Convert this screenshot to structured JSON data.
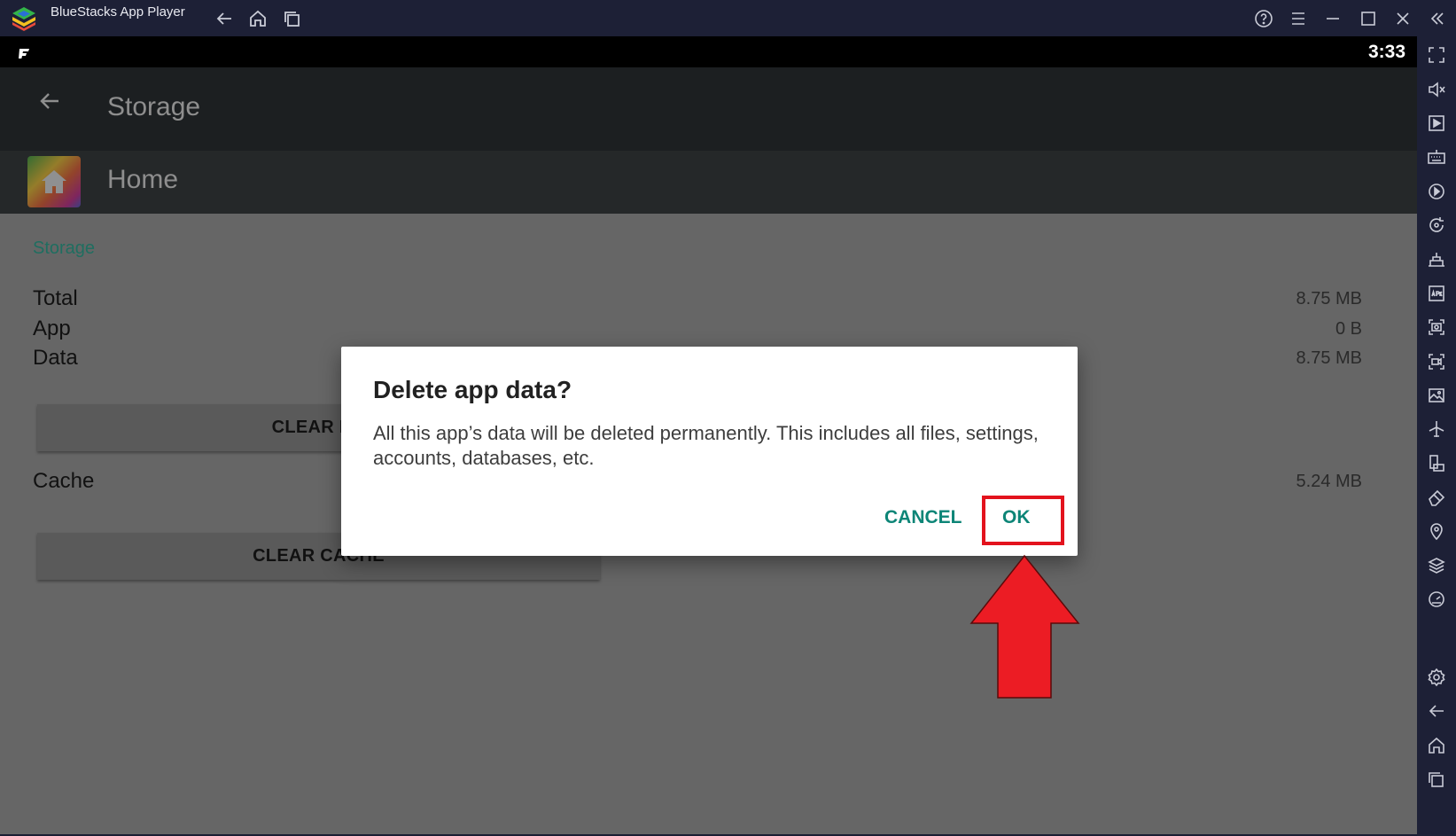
{
  "window": {
    "title": "BlueStacks App Player",
    "colors": {
      "frame": "#1d2036",
      "accent": "#0d8577",
      "highlight": "#e3131d"
    }
  },
  "titlebar_icons": [
    "back-icon",
    "home-icon",
    "recent-apps-icon",
    "help-icon",
    "menu-icon",
    "minimize-icon",
    "maximize-icon",
    "close-icon",
    "collapse-sidebar-icon"
  ],
  "statusbar": {
    "time": "3:33"
  },
  "appbar": {
    "title": "Storage"
  },
  "app_row": {
    "name": "Home"
  },
  "storage": {
    "section_title": "Storage",
    "rows": [
      {
        "label": "Total",
        "value": "8.75 MB"
      },
      {
        "label": "App",
        "value": "0 B"
      },
      {
        "label": "Data",
        "value": "8.75 MB"
      }
    ],
    "clear_data_label": "CLEAR DA",
    "cache_label": "Cache",
    "cache_value": "5.24 MB",
    "clear_cache_label": "CLEAR CACHE"
  },
  "dialog": {
    "title": "Delete app data?",
    "body": "All this app’s data will be deleted permanently. This includes all files, settings, accounts, databases, etc.",
    "cancel_label": "CANCEL",
    "ok_label": "OK"
  },
  "sidebar_icons": [
    "fullscreen-icon",
    "volume-icon",
    "media-icon",
    "keyboard-icon",
    "macro-icon",
    "rotate-icon",
    "build-icon",
    "apk-icon",
    "screenshot-icon",
    "record-icon",
    "gallery-icon",
    "airplane-icon",
    "device-icon",
    "eraser-icon",
    "location-icon",
    "layers-icon",
    "speed-icon",
    "settings-icon",
    "back-icon",
    "home-icon",
    "recent-apps-icon"
  ]
}
